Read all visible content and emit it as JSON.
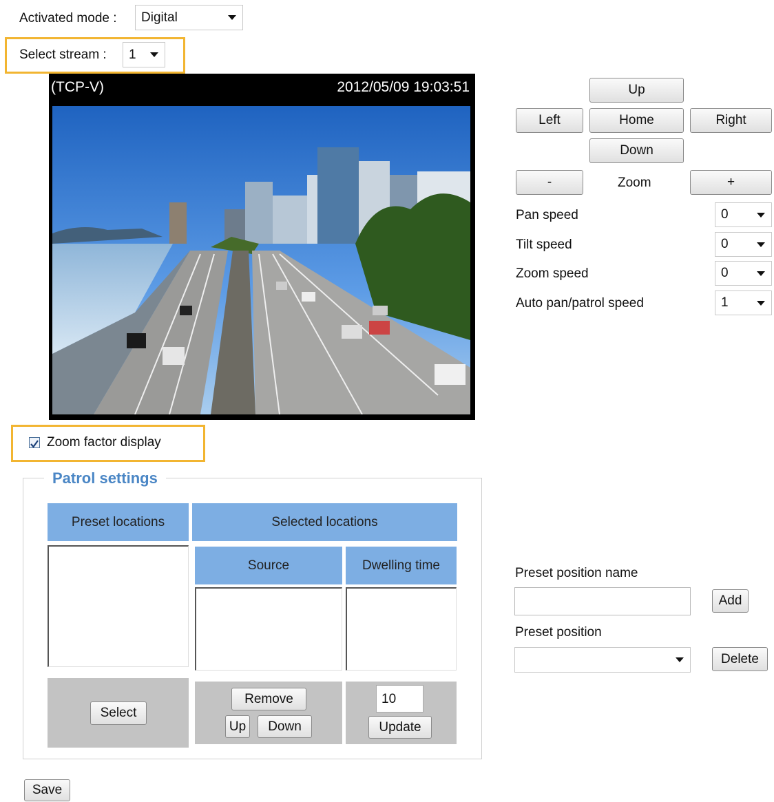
{
  "activated_mode": {
    "label": "Activated mode :",
    "value": "Digital"
  },
  "select_stream": {
    "label": "Select stream :",
    "value": "1"
  },
  "video": {
    "protocol": "(TCP-V)",
    "timestamp": "2012/05/09 19:03:51"
  },
  "ptz": {
    "up": "Up",
    "left": "Left",
    "home": "Home",
    "right": "Right",
    "down": "Down",
    "zoom_out": "-",
    "zoom_label": "Zoom",
    "zoom_in": "+"
  },
  "speeds": [
    {
      "label": "Pan speed",
      "value": "0"
    },
    {
      "label": "Tilt speed",
      "value": "0"
    },
    {
      "label": "Zoom speed",
      "value": "0"
    },
    {
      "label": "Auto pan/patrol speed",
      "value": "1"
    }
  ],
  "zoom_factor": {
    "label": "Zoom factor display",
    "checked": true
  },
  "patrol": {
    "title": "Patrol settings",
    "preset_locations": "Preset locations",
    "selected_locations": "Selected locations",
    "source": "Source",
    "dwelling_time": "Dwelling time",
    "select_btn": "Select",
    "remove_btn": "Remove",
    "up_btn": "Up",
    "down_btn": "Down",
    "dwell_value": "10",
    "update_btn": "Update"
  },
  "preset": {
    "name_label": "Preset position name",
    "name_value": "",
    "add_btn": "Add",
    "position_label": "Preset position",
    "position_value": "",
    "delete_btn": "Delete"
  },
  "save_btn": "Save",
  "colors": {
    "highlight": "#f2b531",
    "header_blue": "#7daee3",
    "title_blue": "#4a86c5"
  }
}
